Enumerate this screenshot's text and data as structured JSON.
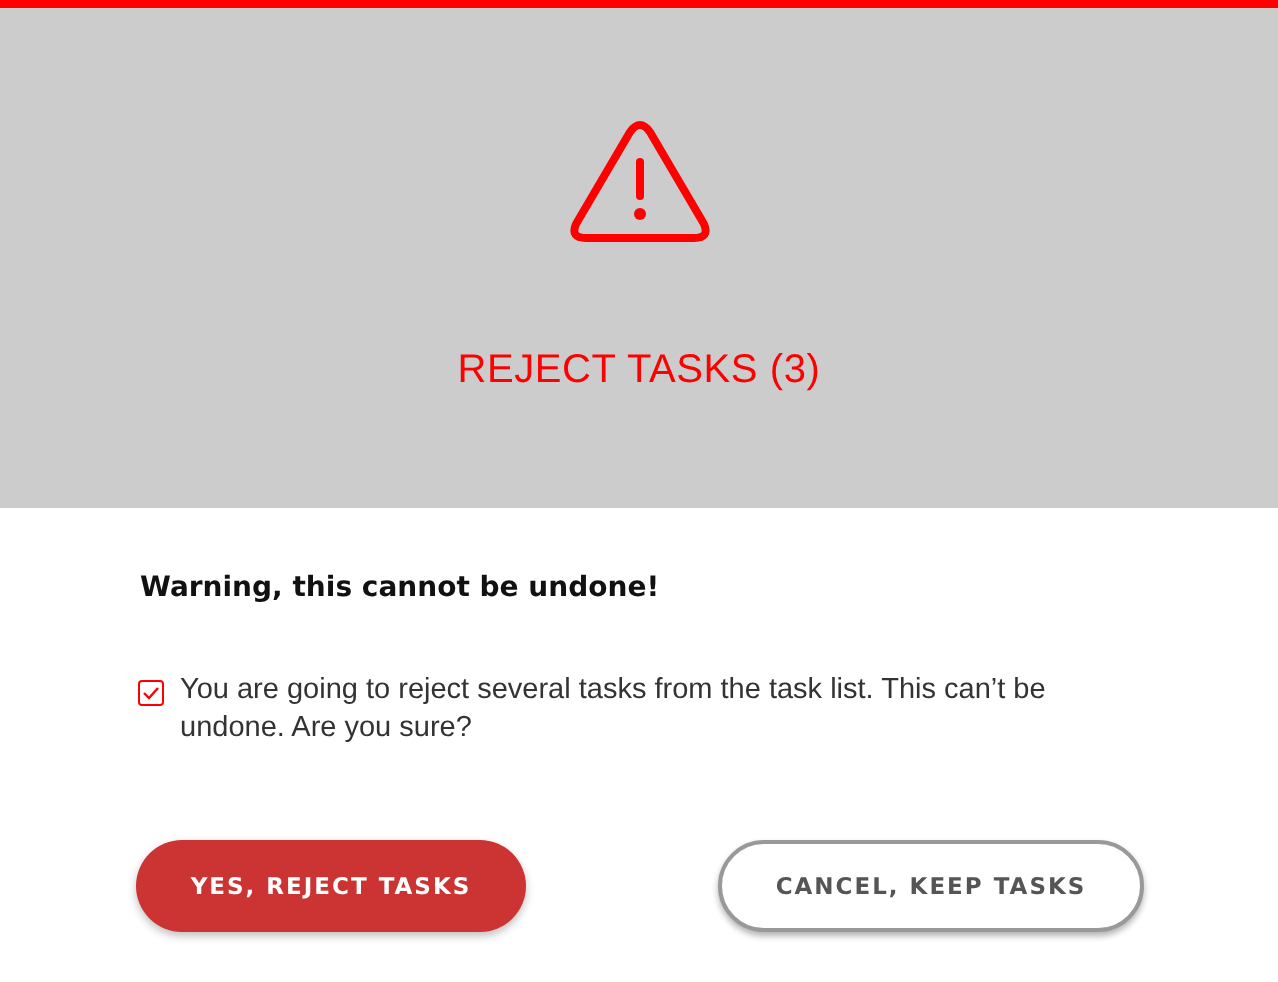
{
  "dialog": {
    "title": "REJECT TASKS (3)",
    "warning": "Warning, this cannot be undone!",
    "confirm": {
      "checked": true,
      "label": "You are going to reject several tasks from the task list. This can’t be undone. Are you sure?"
    },
    "buttons": [
      {
        "kind": "primary",
        "label": "YES, REJECT TASKS"
      },
      {
        "kind": "secondary",
        "label": "CANCEL, KEEP TASKS"
      }
    ]
  }
}
